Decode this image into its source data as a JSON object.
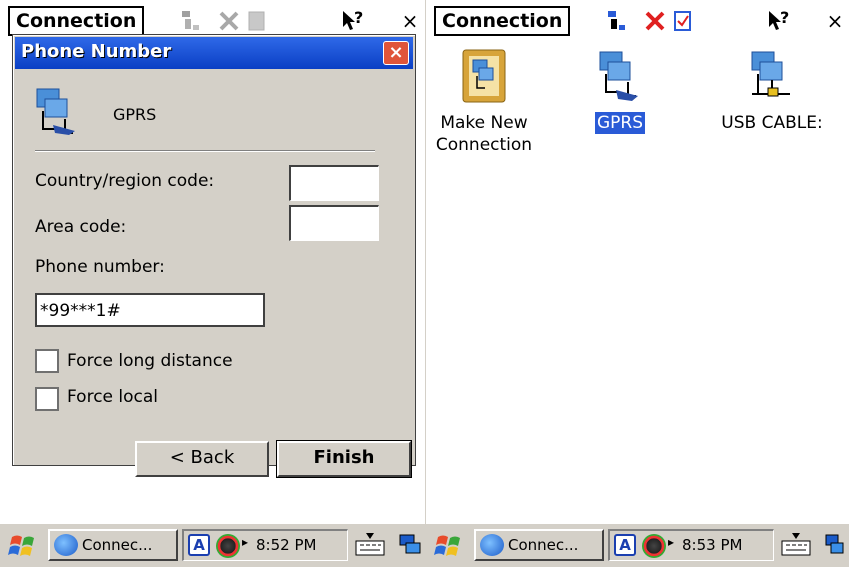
{
  "left": {
    "command_bar": {
      "title": "Connection",
      "close_label": "×"
    },
    "dialog": {
      "title": "Phone Number",
      "close_label": "×",
      "connection_name": "GPRS",
      "country_label": "Country/region code:",
      "area_label": "Area code:",
      "phone_label": "Phone number:",
      "country_value": "",
      "area_value": "",
      "phone_value": "*99***1#",
      "force_long_label": "Force long distance",
      "force_local_label": "Force local",
      "back_label": "< Back",
      "finish_label": "Finish",
      "force_long_checked": false,
      "force_local_checked": false
    },
    "taskbar": {
      "task_label": "Connec...",
      "tray_a": "A",
      "time": "8:52 PM"
    }
  },
  "right": {
    "command_bar": {
      "title": "Connection",
      "close_label": "×"
    },
    "icons": [
      {
        "label_line1": "Make New",
        "label_line2": "Connection",
        "selected": false
      },
      {
        "label_line1": "GPRS",
        "label_line2": "",
        "selected": true
      },
      {
        "label_line1": "USB CABLE:",
        "label_line2": "",
        "selected": false
      }
    ],
    "taskbar": {
      "task_label": "Connec...",
      "tray_a": "A",
      "time": "8:53 PM"
    }
  },
  "colors": {
    "titlebar": "#0a3fc4",
    "selection": "#2a5bd7",
    "chrome": "#d4d0c8",
    "delete_red": "#e02020"
  }
}
